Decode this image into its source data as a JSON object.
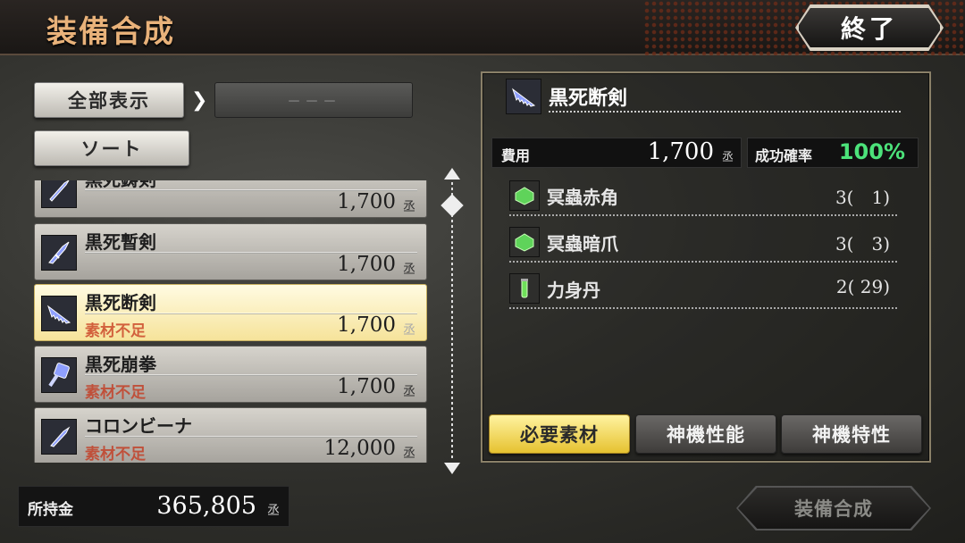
{
  "header": {
    "title": "装備合成",
    "end_label": "終了"
  },
  "filter": {
    "show_all_label": "全部表示",
    "chevron": "❯",
    "sub_filter_value": "－－－",
    "sort_label": "ソート"
  },
  "list": {
    "items": [
      {
        "name": "黒死鋳剣",
        "warning": "",
        "price": "1,700",
        "unit": "丞",
        "icon": "sword-icon"
      },
      {
        "name": "黒死暫剣",
        "warning": "",
        "price": "1,700",
        "unit": "丞",
        "icon": "sword-icon"
      },
      {
        "name": "黒死断剣",
        "warning": "素材不足",
        "price": "1,700",
        "unit": "丞",
        "icon": "serrated-sword-icon",
        "selected": true
      },
      {
        "name": "黒死崩拳",
        "warning": "素材不足",
        "price": "1,700",
        "unit": "丞",
        "icon": "fist-weapon-icon"
      },
      {
        "name": "コロンビーナ",
        "warning": "素材不足",
        "price": "12,000",
        "unit": "丞",
        "icon": "sword-icon"
      }
    ]
  },
  "money": {
    "label": "所持金",
    "value": "365,805",
    "unit": "丞"
  },
  "detail": {
    "name": "黒死断剣",
    "cost_label": "費用",
    "cost_value": "1,700",
    "cost_unit": "丞",
    "rate_label": "成功確率",
    "rate_value": "100%",
    "materials": [
      {
        "name": "冥蟲赤角",
        "qty": "3(　1)",
        "icon": "green-gem-icon"
      },
      {
        "name": "冥蟲暗爪",
        "qty": "3(　3)",
        "icon": "green-gem-icon"
      },
      {
        "name": "力身丹",
        "qty": "2( 29)",
        "icon": "potion-icon"
      }
    ],
    "tabs": [
      {
        "label": "必要素材",
        "active": true
      },
      {
        "label": "神機性能",
        "active": false
      },
      {
        "label": "神機特性",
        "active": false
      }
    ]
  },
  "synth_button": {
    "label": "装備合成"
  },
  "colors": {
    "title": "#e9b27a",
    "rate": "#4ce27a",
    "warning": "#c0503a",
    "selected_bg": "#fff5c0"
  }
}
